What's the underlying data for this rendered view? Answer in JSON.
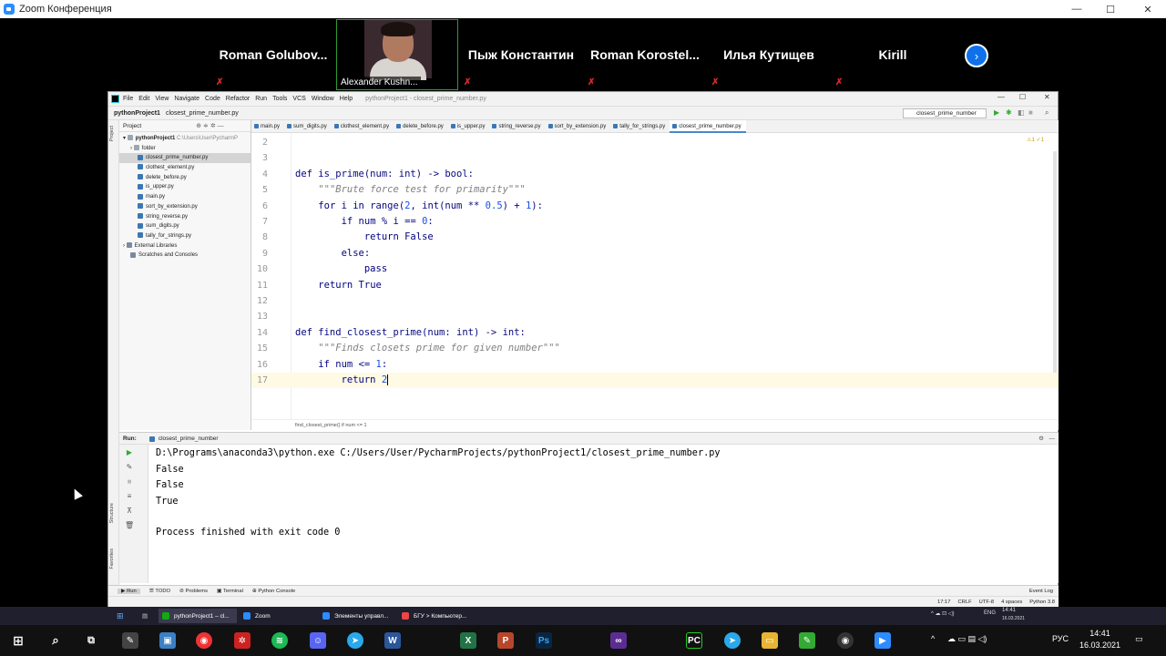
{
  "zoom": {
    "title": "Zoom Конференция",
    "win_min": "—",
    "win_max": "☐",
    "win_close": "✕",
    "participants": [
      {
        "name": "Roman  Golubov..."
      },
      {
        "name": "Alexander Kushn..."
      },
      {
        "name": "Пыж Константин"
      },
      {
        "name": "Roman  Korostel..."
      },
      {
        "name": "Илья Кутищев"
      },
      {
        "name": "Kirill"
      }
    ],
    "mic_glyph": "✗",
    "next_glyph": "›"
  },
  "ide": {
    "menu": [
      "File",
      "Edit",
      "View",
      "Navigate",
      "Code",
      "Refactor",
      "Run",
      "Tools",
      "VCS",
      "Window",
      "Help"
    ],
    "window_title": "pythonProject1 - closest_prime_number.py",
    "nav_project": "pythonProject1",
    "nav_file": "closest_prime_number.py",
    "run_config": "closest_prime_number",
    "project_header": "Project",
    "project_root": "pythonProject1",
    "project_root_path": "C:\\Users\\User\\PycharmP",
    "tree": [
      "folder",
      "closest_prime_number.py",
      "clothest_element.py",
      "delete_before.py",
      "is_upper.py",
      "main.py",
      "sort_by_extension.py",
      "string_reverse.py",
      "sum_digits.py",
      "tally_for_strings.py"
    ],
    "external_libraries": "External Libraries",
    "scratches": "Scratches and Consoles",
    "tabs": [
      "main.py",
      "sum_digits.py",
      "clothest_element.py",
      "delete_before.py",
      "is_upper.py",
      "string_reverse.py",
      "sort_by_extension.py",
      "tally_for_strings.py",
      "closest_prime_number.py"
    ],
    "warnings": "⚠1  ✓1",
    "breadcrumb": "find_closest_prime()    if num <= 1",
    "run_label": "Run:",
    "run_tab": "closest_prime_number",
    "console": [
      "D:\\Programs\\anaconda3\\python.exe C:/Users/User/PycharmProjects/pythonProject1/closest_prime_number.py",
      "False",
      "False",
      "True",
      "Process finished with exit code 0"
    ],
    "bottom_tabs": [
      "▶ Run",
      "☰ TODO",
      "⊘ Problems",
      "▣ Terminal",
      "⊕ Python Console"
    ],
    "event_log": "Event Log",
    "status": [
      "17:17",
      "CRLF",
      "UTF-8",
      "4 spaces",
      "Python 3.8"
    ],
    "side_tabs": [
      "Project",
      "Structure",
      "Favorites"
    ]
  },
  "taskbar": {
    "tasks": [
      "pythonProject1 – cl...",
      "Zoom",
      "Элементы управл...",
      "БГУ > Компьютер..."
    ],
    "tray_lang": "ENG",
    "tray_date_small": "16.03.2021",
    "tray_time_small": "14:41",
    "lang": "РУС",
    "time": "14:41",
    "date": "16.03.2021"
  }
}
